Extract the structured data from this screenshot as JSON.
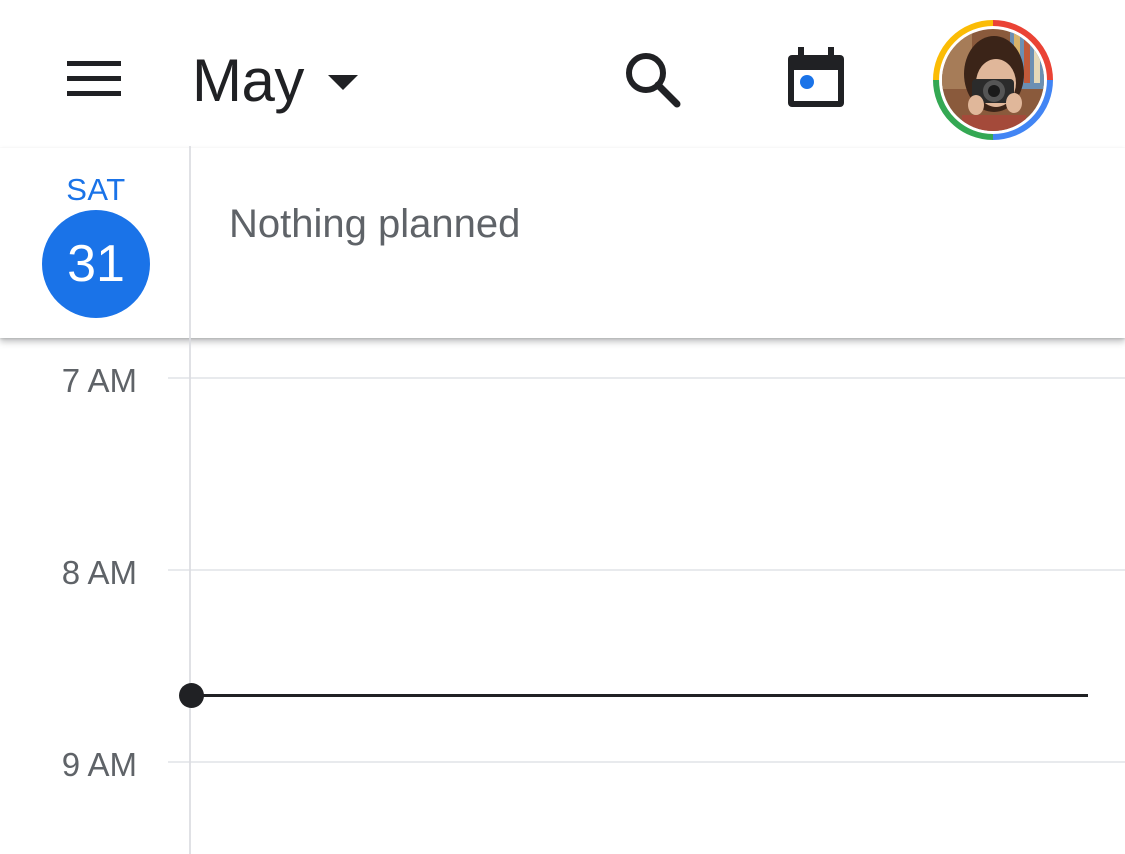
{
  "header": {
    "month": "May",
    "icons": {
      "menu": "menu-icon",
      "dropdown": "arrow-drop-down-icon",
      "search": "search-icon",
      "today": "calendar-today-icon",
      "avatar": "account-avatar"
    }
  },
  "day": {
    "weekday": "SAT",
    "date": "31",
    "empty_message": "Nothing planned"
  },
  "time_grid": {
    "hours": [
      "7 AM",
      "8 AM",
      "9 AM"
    ]
  },
  "colors": {
    "accent": "#1a73e8",
    "text_primary": "#202124",
    "text_secondary": "#5f6368",
    "grid_line": "#e8eaed"
  }
}
